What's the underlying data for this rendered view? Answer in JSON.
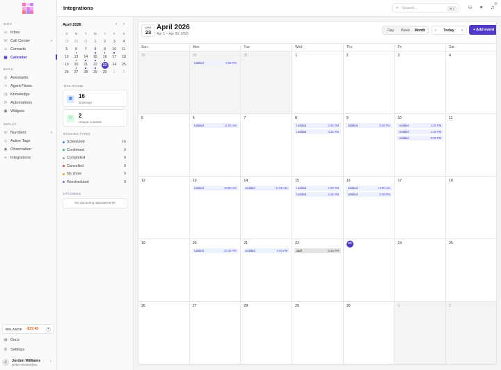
{
  "app": {
    "logo_colors": [
      "#f472b6",
      "#fbcfe8",
      "#c084fc",
      "#f9a8d4",
      "#e879f9",
      "#f0abfc",
      "#fb7185",
      "#a78bfa",
      "#f472b6"
    ]
  },
  "sidebar": {
    "sections": [
      {
        "label": "MAIN",
        "items": [
          {
            "label": "Inbox",
            "icon": "inbox-icon",
            "glyph": "▭"
          },
          {
            "label": "Call Center",
            "icon": "phone-icon",
            "glyph": "☏",
            "chevron": "›"
          },
          {
            "label": "Contacts",
            "icon": "contacts-icon",
            "glyph": "☺"
          },
          {
            "label": "Calendar",
            "icon": "calendar-icon",
            "glyph": "▦",
            "active": true
          }
        ]
      },
      {
        "label": "BUILD",
        "items": [
          {
            "label": "Assistants",
            "icon": "assistant-icon",
            "glyph": "◎"
          },
          {
            "label": "Agent Flows",
            "icon": "flow-icon",
            "glyph": "⤳"
          },
          {
            "label": "Knowledge",
            "icon": "knowledge-icon",
            "glyph": "◷"
          },
          {
            "label": "Automations",
            "icon": "automation-icon",
            "glyph": "⟳"
          },
          {
            "label": "Widgets",
            "icon": "widget-icon",
            "glyph": "▣"
          }
        ]
      },
      {
        "label": "DEPLOY",
        "items": [
          {
            "label": "Numbers",
            "icon": "numbers-icon",
            "glyph": "☏",
            "chevron": "›"
          },
          {
            "label": "Active Tags",
            "icon": "tag-icon",
            "glyph": "◇"
          },
          {
            "label": "Observation",
            "icon": "eye-icon",
            "glyph": "◉"
          },
          {
            "label": "Integrations",
            "icon": "link-icon",
            "glyph": "∞"
          }
        ]
      }
    ],
    "balance": {
      "label": "BALANCE",
      "amount": "-$37.40",
      "plus": "+"
    },
    "bottom": [
      {
        "label": "Docs",
        "icon": "docs-icon",
        "glyph": "▤"
      },
      {
        "label": "Settings",
        "icon": "settings-icon",
        "glyph": "⚙"
      }
    ],
    "user": {
      "initial": "J",
      "name": "Jorden Williams",
      "email": "jorden+devtest@ex...",
      "chevron": "⌃"
    }
  },
  "header": {
    "title": "Integrations",
    "search": {
      "placeholder": "Search...",
      "shortcut": "⌘ K",
      "icon_glyph": "⌕"
    },
    "icons": [
      {
        "name": "people-icon",
        "glyph": "⚇"
      },
      {
        "name": "link-icon",
        "glyph": "⚭"
      },
      {
        "name": "bell-icon",
        "glyph": "♫"
      }
    ],
    "notif_count": "0"
  },
  "mini_calendar": {
    "title": "April 2026",
    "prev": "‹",
    "next": "›",
    "weekdays": [
      "S",
      "M",
      "T",
      "W",
      "T",
      "F",
      "S"
    ],
    "weeks": [
      [
        {
          "n": "29",
          "o": 1
        },
        {
          "n": "30",
          "o": 1
        },
        {
          "n": "31",
          "o": 1
        },
        {
          "n": "1"
        },
        {
          "n": "2"
        },
        {
          "n": "3"
        },
        {
          "n": "4"
        }
      ],
      [
        {
          "n": "5"
        },
        {
          "n": "6",
          "dot": 1
        },
        {
          "n": "7"
        },
        {
          "n": "8",
          "dot": 1
        },
        {
          "n": "9",
          "dot": 1
        },
        {
          "n": "10",
          "dot": 1
        },
        {
          "n": "11"
        }
      ],
      [
        {
          "n": "12"
        },
        {
          "n": "13",
          "dot": 1
        },
        {
          "n": "14",
          "dot": 1
        },
        {
          "n": "15",
          "dot": 1
        },
        {
          "n": "16",
          "dot": 1
        },
        {
          "n": "17"
        },
        {
          "n": "18"
        }
      ],
      [
        {
          "n": "19"
        },
        {
          "n": "20",
          "dot": 1
        },
        {
          "n": "21",
          "dot": 1
        },
        {
          "n": "22",
          "dot": 1
        },
        {
          "n": "23",
          "today": 1
        },
        {
          "n": "24"
        },
        {
          "n": "25"
        }
      ],
      [
        {
          "n": "26"
        },
        {
          "n": "27"
        },
        {
          "n": "28"
        },
        {
          "n": "29"
        },
        {
          "n": "30"
        },
        {
          "n": "1",
          "o": 1
        },
        {
          "n": "2",
          "o": 1
        }
      ]
    ]
  },
  "range": {
    "label": "THIS RANGE",
    "bookings": {
      "value": "16",
      "label": "Bookings",
      "glyph": "▦"
    },
    "contacts": {
      "value": "2",
      "label": "Unique contacts",
      "glyph": "⚇"
    }
  },
  "booking_types": {
    "label": "BOOKING TYPES",
    "items": [
      {
        "label": "Scheduled",
        "count": "16",
        "color": "#3b82f6"
      },
      {
        "label": "Confirmed",
        "count": "0",
        "color": "#22c55e"
      },
      {
        "label": "Completed",
        "count": "0",
        "color": "#a1a1aa"
      },
      {
        "label": "Cancelled",
        "count": "0",
        "color": "#ef4444"
      },
      {
        "label": "No show",
        "count": "0",
        "color": "#f59e0b"
      },
      {
        "label": "Rescheduled",
        "count": "0",
        "color": "#8b5cf6"
      }
    ]
  },
  "upcoming": {
    "label": "UPCOMING",
    "empty": "No upcoming appointments"
  },
  "calendar": {
    "date_month": "APR",
    "date_day": "23",
    "title": "April 2026",
    "range": "Apr 1 – Apr 30, 2026",
    "views": [
      "Day",
      "Week",
      "Month"
    ],
    "active_view": "Month",
    "prev": "‹",
    "next": "›",
    "today_label": "Today",
    "add_label": "+ Add event",
    "weekdays": [
      "Sun",
      "Mon",
      "Tue",
      "Wed",
      "Thu",
      "Fri",
      "Sat"
    ],
    "weeks": [
      [
        {
          "n": "29",
          "o": 1,
          "ev": []
        },
        {
          "n": "30",
          "o": 1,
          "ev": [
            {
              "t": "Untitled",
              "time": "2:00 PM"
            }
          ]
        },
        {
          "n": "31",
          "o": 1,
          "ev": []
        },
        {
          "n": "1",
          "ev": []
        },
        {
          "n": "2",
          "ev": []
        },
        {
          "n": "3",
          "ev": []
        },
        {
          "n": "4",
          "ev": []
        }
      ],
      [
        {
          "n": "5",
          "ev": []
        },
        {
          "n": "6",
          "ev": [
            {
              "t": "Untitled",
              "time": "11:00 AM"
            }
          ]
        },
        {
          "n": "7",
          "ev": []
        },
        {
          "n": "8",
          "ev": [
            {
              "t": "Untitled",
              "time": "3:00 PM"
            },
            {
              "t": "Untitled",
              "time": "4:45 PM"
            }
          ]
        },
        {
          "n": "9",
          "ev": [
            {
              "t": "Untitled",
              "time": "3:00 PM"
            }
          ]
        },
        {
          "n": "10",
          "ev": [
            {
              "t": "Untitled",
              "time": "1:00 PM"
            },
            {
              "t": "Untitled",
              "time": "1:30 PM"
            },
            {
              "t": "Untitled",
              "time": "3:00 PM"
            }
          ]
        },
        {
          "n": "11",
          "ev": []
        }
      ],
      [
        {
          "n": "12",
          "ev": []
        },
        {
          "n": "13",
          "ev": [
            {
              "t": "Untitled",
              "time": "10:00 AM"
            }
          ]
        },
        {
          "n": "14",
          "ev": [
            {
              "t": "Untitled",
              "time": "11:00 AM"
            }
          ]
        },
        {
          "n": "15",
          "ev": [
            {
              "t": "Untitled",
              "time": "1:00 PM"
            },
            {
              "t": "Untitled",
              "time": "4:45 PM"
            }
          ]
        },
        {
          "n": "16",
          "ev": [
            {
              "t": "Untitled",
              "time": "11:00 AM"
            },
            {
              "t": "Untitled",
              "time": "3:00 PM"
            }
          ]
        },
        {
          "n": "17",
          "ev": []
        },
        {
          "n": "18",
          "ev": []
        }
      ],
      [
        {
          "n": "19",
          "ev": []
        },
        {
          "n": "20",
          "ev": [
            {
              "t": "Untitled",
              "time": "12:30 PM"
            }
          ]
        },
        {
          "n": "21",
          "ev": [
            {
              "t": "Untitled",
              "time": "3:00 PM"
            }
          ]
        },
        {
          "n": "22",
          "ev": [
            {
              "t": "asdf",
              "time": "5:00 PM",
              "gray": 1
            }
          ]
        },
        {
          "n": "23",
          "today": 1,
          "ev": []
        },
        {
          "n": "24",
          "ev": []
        },
        {
          "n": "25",
          "ev": []
        }
      ],
      [
        {
          "n": "26",
          "ev": []
        },
        {
          "n": "27",
          "ev": []
        },
        {
          "n": "28",
          "ev": []
        },
        {
          "n": "29",
          "ev": []
        },
        {
          "n": "30",
          "ev": []
        },
        {
          "n": "1",
          "o": 1,
          "ev": []
        },
        {
          "n": "2",
          "o": 1,
          "ev": []
        }
      ]
    ]
  }
}
